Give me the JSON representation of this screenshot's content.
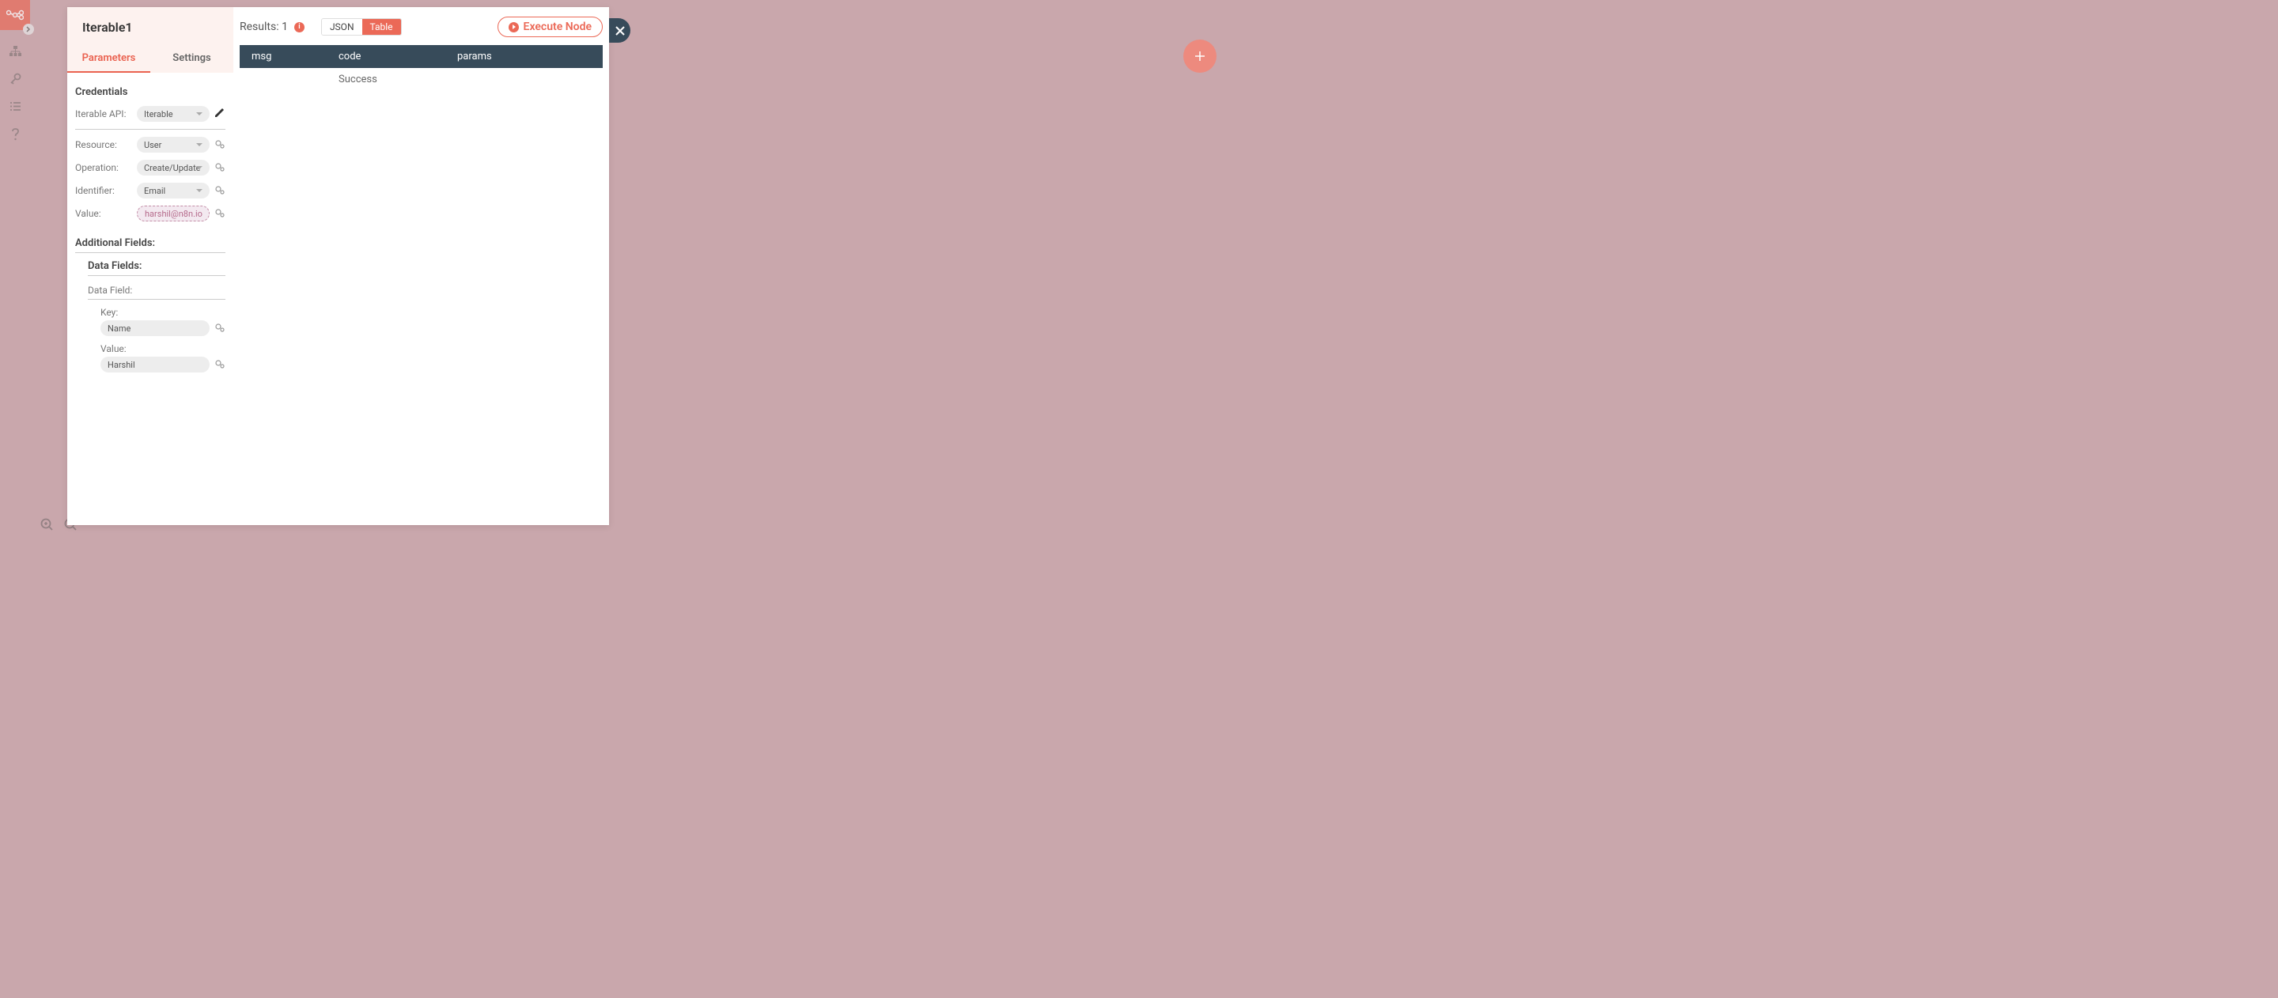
{
  "sidebar": {
    "items": [
      {
        "id": "logo"
      },
      {
        "id": "workflows"
      },
      {
        "id": "credentials"
      },
      {
        "id": "executions"
      },
      {
        "id": "help"
      }
    ]
  },
  "node": {
    "title": "Iterable1",
    "tabs": {
      "parameters": "Parameters",
      "settings": "Settings"
    }
  },
  "params": {
    "credentials_label": "Credentials",
    "iterable_api_label": "Iterable API:",
    "iterable_api_value": "Iterable",
    "resource_label": "Resource:",
    "resource_value": "User",
    "operation_label": "Operation:",
    "operation_value": "Create/Update",
    "identifier_label": "Identifier:",
    "identifier_value": "Email",
    "value_label": "Value:",
    "value_value": "harshil@n8n.io",
    "additional_fields_label": "Additional Fields:",
    "data_fields_label": "Data Fields:",
    "data_field_label": "Data Field:",
    "key_label": "Key:",
    "key_value": "Name",
    "df_value_label": "Value:",
    "df_value_value": "Harshil"
  },
  "results": {
    "label": "Results: 1",
    "view_json": "JSON",
    "view_table": "Table",
    "execute": "Execute Node",
    "headers": {
      "msg": "msg",
      "code": "code",
      "params": "params"
    },
    "rows": [
      {
        "msg": "",
        "code": "Success",
        "params": ""
      }
    ]
  }
}
